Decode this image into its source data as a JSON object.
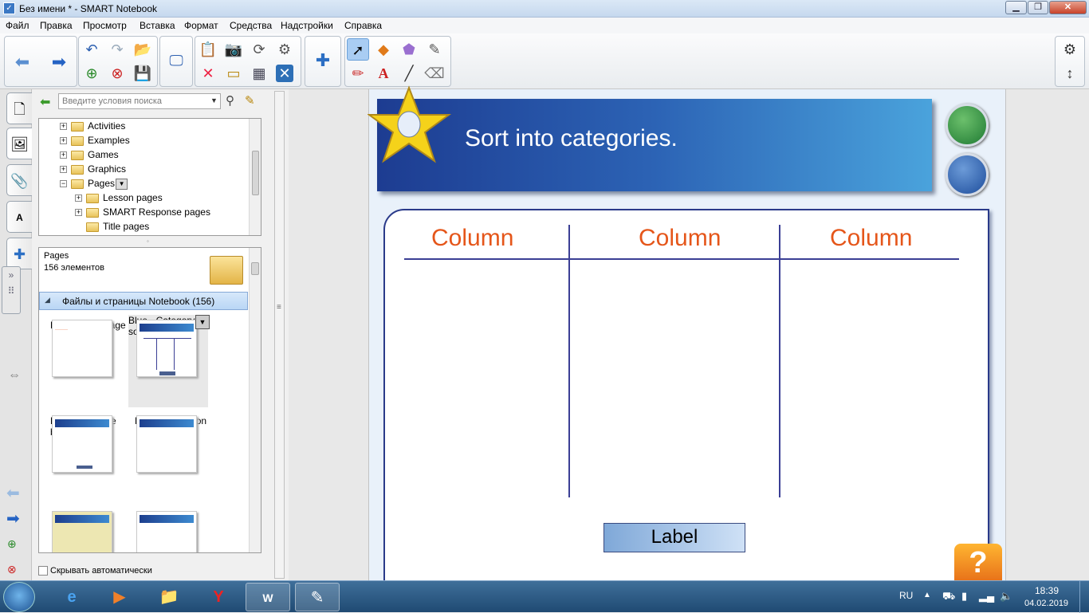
{
  "window": {
    "title": "Без имени * - SMART Notebook",
    "app_icon": "notebook-icon",
    "controls": [
      "minimize-icon",
      "restore-icon",
      "close-icon"
    ]
  },
  "menu": [
    "Файл",
    "Правка",
    "Просмотр",
    "Вставка",
    "Формат",
    "Средства",
    "Надстройки",
    "Справка"
  ],
  "toolbar": {
    "buttons": [
      "back-icon",
      "forward-icon",
      "undo-icon",
      "redo-icon",
      "open-icon",
      "save-icon",
      "add-page-icon",
      "delete-page-icon",
      "screen-icon",
      "paste-icon",
      "screen-shade-icon",
      "crop-icon",
      "table-icon",
      "document-camera-icon",
      "measurement-icon",
      "delete-icon",
      "fullscreen-icon",
      "addons-icon",
      "select-icon",
      "shapes-icon",
      "erase-ink-icon",
      "magic-pen-icon",
      "pens-icon",
      "text-icon",
      "line-icon",
      "eraser-icon",
      "settings-icon",
      "move-toolbar-icon"
    ]
  },
  "gallery": {
    "search_placeholder": "Введите условия поиска",
    "tree": [
      {
        "label": "Activities"
      },
      {
        "label": "Examples"
      },
      {
        "label": "Games"
      },
      {
        "label": "Graphics"
      },
      {
        "label": "Pages"
      },
      {
        "label": "Lesson pages"
      },
      {
        "label": "SMART Response pages"
      },
      {
        "label": "Title pages"
      }
    ],
    "content": {
      "title": "Pages",
      "count": "156 элементов",
      "section": "Файлы и страницы Notebook (156)",
      "items": [
        {
          "label": "Blue - Blank page"
        },
        {
          "label": "Blue - Category sort"
        },
        {
          "label": "Blue - Fill in the blank"
        },
        {
          "label": "Blue - Instruction"
        }
      ]
    },
    "autohide": "Скрывать автоматически"
  },
  "page": {
    "title": "Sort into categories.",
    "columns": [
      "Column",
      "Column",
      "Column"
    ],
    "label": "Label",
    "buttons": [
      "home-icon",
      "notes-icon",
      "help-icon"
    ]
  },
  "taskbar": {
    "apps": [
      "ie-icon",
      "media-icon",
      "explorer-icon",
      "yandex-icon",
      "word-icon",
      "notebook-icon"
    ],
    "lang": "RU",
    "time": "18:39",
    "date": "04.02.2019"
  },
  "colors": {
    "accent": "#2c63b5",
    "column_head": "#e5561a",
    "grid_line": "#3b3f95"
  }
}
